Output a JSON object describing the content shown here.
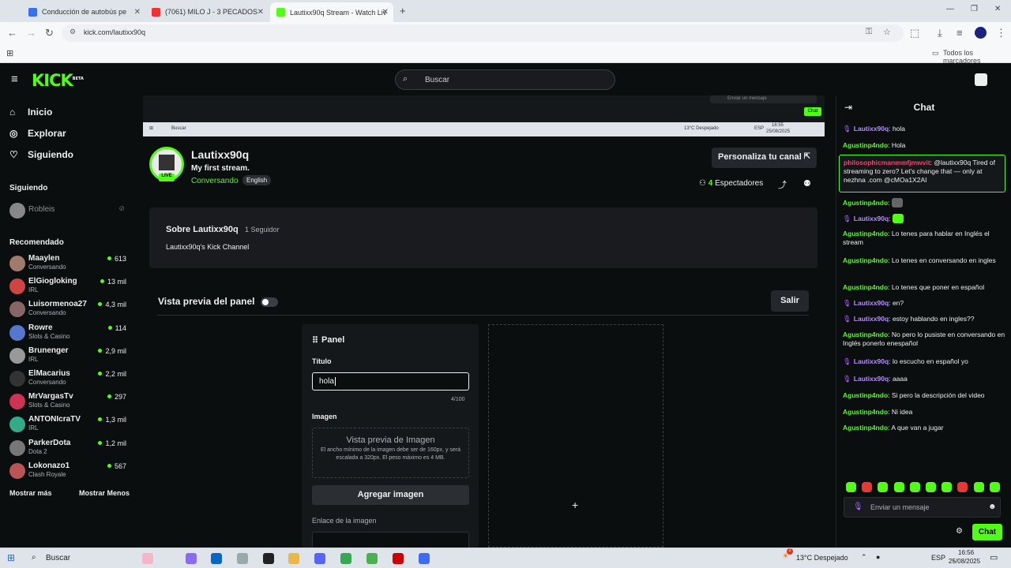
{
  "browser": {
    "tabs": [
      {
        "title": "Conducción de autobús pe",
        "color": "#3a6ff0"
      },
      {
        "title": "(7061) MILO J - 3 PECADOS",
        "color": "#e33"
      },
      {
        "title": "Lautixx90q Stream - Watch Liv",
        "color": "#53fc18"
      }
    ],
    "new_tab": "+",
    "url": "kick.com/lautixx90q",
    "bookmarks_all": "Todos los marcadores"
  },
  "kick": {
    "logo": "KICK",
    "logo_beta": "BETA",
    "search_placeholder": "Buscar"
  },
  "sidebar": {
    "nav": [
      {
        "label": "Inicio",
        "icon": "home-icon",
        "glyph": "⌂"
      },
      {
        "label": "Explorar",
        "icon": "compass-icon",
        "glyph": "◎"
      },
      {
        "label": "Siguiendo",
        "icon": "heart-icon",
        "glyph": "♡"
      }
    ],
    "following_head": "Siguiendo",
    "following": [
      {
        "name": "Robleis"
      }
    ],
    "recommended_head": "Recomendado",
    "recommended": [
      {
        "name": "Maaylen",
        "category": "Conversando",
        "viewers": "613",
        "color": "#a07a6a"
      },
      {
        "name": "ElGiogloking",
        "category": "IRL",
        "viewers": "13 mil",
        "color": "#c44"
      },
      {
        "name": "Luisormenoa27",
        "category": "Conversando",
        "viewers": "4,3 mil",
        "color": "#866"
      },
      {
        "name": "Rowre",
        "category": "Slots & Casino",
        "viewers": "114",
        "color": "#57c"
      },
      {
        "name": "Brunenger",
        "category": "IRL",
        "viewers": "2,9 mil",
        "color": "#999"
      },
      {
        "name": "ElMacarius",
        "category": "Conversando",
        "viewers": "2,2 mil",
        "color": "#333"
      },
      {
        "name": "MrVargasTv",
        "category": "Slots & Casino",
        "viewers": "297",
        "color": "#c35"
      },
      {
        "name": "ANTONIcraTV",
        "category": "IRL",
        "viewers": "1,3 mil",
        "color": "#3a8"
      },
      {
        "name": "ParkerDota",
        "category": "Dota 2",
        "viewers": "1,2 mil",
        "color": "#777"
      },
      {
        "name": "Lokonazo1",
        "category": "Clash Royale",
        "viewers": "567",
        "color": "#b55"
      }
    ],
    "show_more": "Mostrar más",
    "show_less": "Mostrar Menos"
  },
  "channel": {
    "name": "Lautixx90q",
    "stream_title": "My first stream.",
    "category": "Conversando",
    "language": "English",
    "live_badge": "LIVE",
    "customize_button": "Personaliza tu canal",
    "viewers_count": "4",
    "viewers_label": "Espectadores",
    "about_title": "Sobre Lautixx90q",
    "followers": "1 Seguidor",
    "about_desc": "Lautixx90q's Kick Channel"
  },
  "panel_editor": {
    "preview_label": "Vista previa del panel",
    "exit_button": "Salir",
    "panel_title": "Panel",
    "title_label": "Título",
    "title_value": "hola",
    "char_count": "4/100",
    "image_label": "Imagen",
    "image_preview_title": "Vista previa de Imagen",
    "image_preview_desc": "El ancho mínimo de la imagen debe ser de 160px, y será escalada a 320px. El peso máximo es 4 MB.",
    "add_image_button": "Agregar imagen",
    "image_link_label": "Enlace de la imagen",
    "add_panel_glyph": "+"
  },
  "chat": {
    "title": "Chat",
    "pinned": {
      "user": "philosophicmanmmfjmwvit",
      "text": "@lautixx90q Tired of streaming to zero? Let's change that — only at nezhna .com @cMOa1X2AI"
    },
    "messages": [
      {
        "user": "Lautixx90q",
        "text": "hola",
        "mic": true,
        "ucolor": "#b78cff"
      },
      {
        "user": "Agustinp4ndo",
        "text": "Hola",
        "mic": false,
        "ucolor": "#53fc18"
      },
      {
        "user": "Agustinp4ndo",
        "text": "",
        "mic": false,
        "ucolor": "#53fc18"
      },
      {
        "user": "Lautixx90q",
        "text": "",
        "mic": true,
        "ucolor": "#b78cff"
      },
      {
        "user": "Agustinp4ndo",
        "text": "Lo tenes para hablar en Inglés el stream",
        "mic": false,
        "ucolor": "#53fc18"
      },
      {
        "user": "Agustinp4ndo",
        "text": "Lo tenes en conversando en ingles",
        "mic": false,
        "ucolor": "#53fc18"
      },
      {
        "user": "Agustinp4ndo",
        "text": "Lo tenes que poner en español",
        "mic": false,
        "ucolor": "#53fc18"
      },
      {
        "user": "Lautixx90q",
        "text": "en?",
        "mic": true,
        "ucolor": "#b78cff"
      },
      {
        "user": "Lautixx90q",
        "text": "estoy hablando en ingles??",
        "mic": true,
        "ucolor": "#b78cff"
      },
      {
        "user": "Agustinp4ndo",
        "text": "No pero lo pusiste en conversando en Inglés ponerlo enespañol",
        "mic": false,
        "ucolor": "#53fc18"
      },
      {
        "user": "Lautixx90q",
        "text": "lo escucho en español yo",
        "mic": true,
        "ucolor": "#b78cff"
      },
      {
        "user": "Lautixx90q",
        "text": "aaaa",
        "mic": true,
        "ucolor": "#b78cff"
      },
      {
        "user": "Agustinp4ndo",
        "text": "Si pero la descripción del video",
        "mic": false,
        "ucolor": "#53fc18"
      },
      {
        "user": "Agustinp4ndo",
        "text": "Ni idea",
        "mic": false,
        "ucolor": "#53fc18"
      },
      {
        "user": "Agustinp4ndo",
        "text": "A que van a jugar",
        "mic": false,
        "ucolor": "#53fc18"
      }
    ],
    "input_placeholder": "Enviar un mensaje",
    "send_button": "Chat"
  },
  "stream_preview": {
    "search": "Buscar",
    "weather": "13°C Despejado",
    "lang": "ESP",
    "time": "16:55",
    "date": "25/08/2025",
    "chat_button": "Chat",
    "input_placeholder": "Enviar un mensaje"
  },
  "taskbar": {
    "search": "Buscar",
    "weather": "13°C Despejado",
    "lang": "ESP",
    "time": "16:56",
    "date": "25/08/2025",
    "weather_badge": "2"
  }
}
